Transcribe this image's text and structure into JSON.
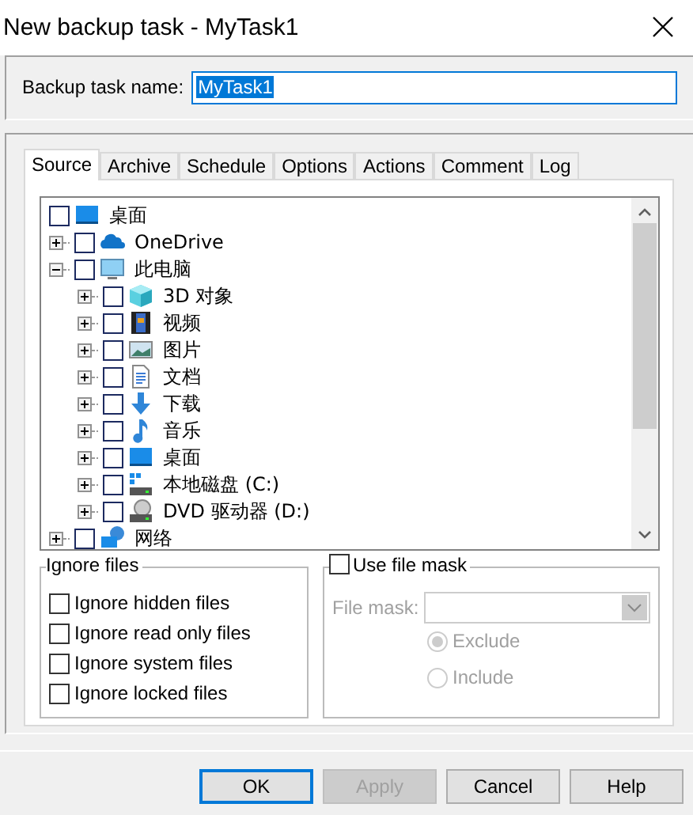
{
  "window": {
    "title": "New backup task - MyTask1"
  },
  "task_name": {
    "label": "Backup task name:",
    "value": "MyTask1"
  },
  "tabs": [
    {
      "label": "Source",
      "selected": true
    },
    {
      "label": "Archive",
      "selected": false
    },
    {
      "label": "Schedule",
      "selected": false
    },
    {
      "label": "Options",
      "selected": false
    },
    {
      "label": "Actions",
      "selected": false
    },
    {
      "label": "Comment",
      "selected": false
    },
    {
      "label": "Log",
      "selected": false
    }
  ],
  "tree": [
    {
      "label": "桌面",
      "kind": "desktop",
      "checked": false
    },
    {
      "label": "OneDrive",
      "kind": "cloud",
      "checked": false,
      "expanded": false
    },
    {
      "label": "此电脑",
      "kind": "computer",
      "checked": false,
      "expanded": true,
      "children": [
        {
          "label": "3D 对象",
          "kind": "cube",
          "checked": false,
          "expanded": false
        },
        {
          "label": "视频",
          "kind": "film",
          "checked": false,
          "expanded": false
        },
        {
          "label": "图片",
          "kind": "image",
          "checked": false,
          "expanded": false
        },
        {
          "label": "文档",
          "kind": "document",
          "checked": false,
          "expanded": false
        },
        {
          "label": "下载",
          "kind": "download",
          "checked": false,
          "expanded": false
        },
        {
          "label": "音乐",
          "kind": "music",
          "checked": false,
          "expanded": false
        },
        {
          "label": "桌面",
          "kind": "desktop",
          "checked": false,
          "expanded": false
        },
        {
          "label": "本地磁盘 (C:)",
          "kind": "drive",
          "checked": false,
          "expanded": false
        },
        {
          "label": "DVD 驱动器 (D:)",
          "kind": "dvd",
          "checked": false,
          "expanded": false
        }
      ]
    },
    {
      "label": "网络",
      "kind": "network",
      "checked": false,
      "expanded": false
    }
  ],
  "ignore_files": {
    "title": "Ignore files",
    "options": [
      {
        "label": "Ignore hidden files",
        "checked": false
      },
      {
        "label": "Ignore read only files",
        "checked": false
      },
      {
        "label": "Ignore system files",
        "checked": false
      },
      {
        "label": "Ignore locked files",
        "checked": false
      }
    ]
  },
  "file_mask": {
    "label": "Use file mask",
    "checked": false,
    "field_label": "File mask:",
    "modes": [
      {
        "label": "Exclude",
        "selected": true
      },
      {
        "label": "Include",
        "selected": false
      }
    ]
  },
  "buttons": [
    {
      "label": "OK",
      "default": true,
      "disabled": false
    },
    {
      "label": "Apply",
      "default": false,
      "disabled": true
    },
    {
      "label": "Cancel",
      "default": false,
      "disabled": false
    },
    {
      "label": "Help",
      "default": false,
      "disabled": false
    }
  ]
}
